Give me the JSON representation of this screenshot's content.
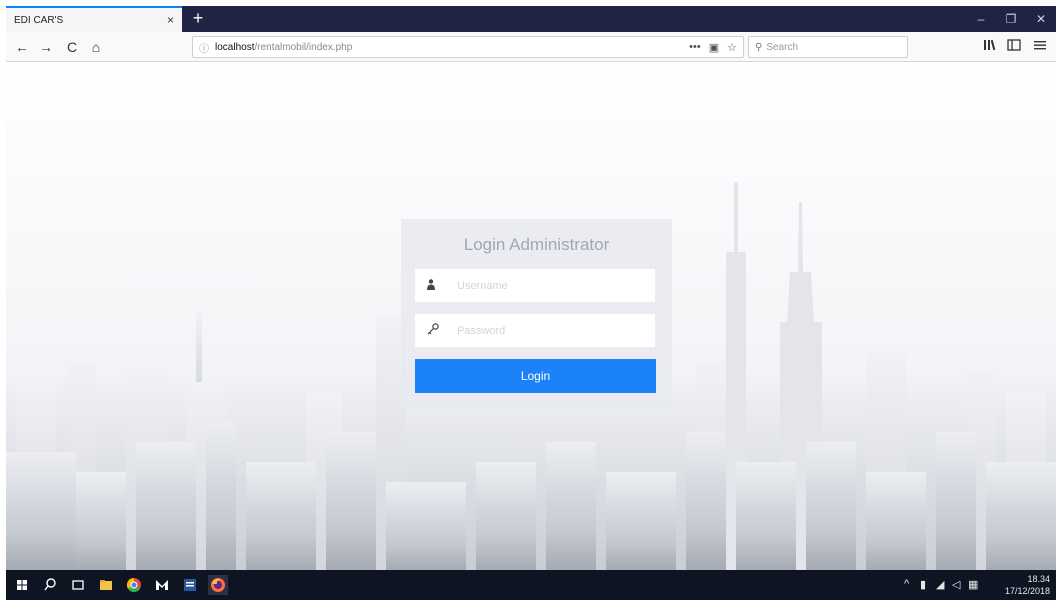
{
  "browser": {
    "tab_title": "EDI CAR'S",
    "tab_close": "×",
    "new_tab": "+",
    "window_minimize": "–",
    "window_restore": "❐",
    "window_close": "✕",
    "nav_back": "←",
    "nav_forward": "→",
    "nav_reload": "C",
    "nav_home": "⌂",
    "url_host": "localhost",
    "url_path": "/rentalmobil/index.php",
    "url_more": "•••",
    "search_placeholder": "Search",
    "library_icon": "library-icon",
    "sidebar_icon": "sidebar-icon",
    "menu_icon": "menu-icon"
  },
  "login": {
    "title": "Login Administrator",
    "username_placeholder": "Username",
    "password_placeholder": "Password",
    "button_label": "Login",
    "accent": "#1c82f8"
  },
  "taskbar": {
    "time": "18.34",
    "date": "17/12/2018"
  }
}
